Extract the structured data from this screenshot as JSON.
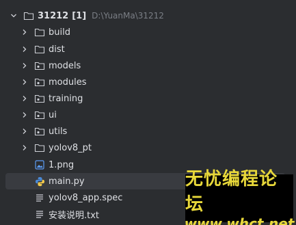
{
  "root": {
    "name": "31212",
    "count": "[1]",
    "path": "D:\\YuanMa\\31212"
  },
  "items": [
    {
      "label": "build",
      "type": "folder",
      "expandable": true
    },
    {
      "label": "dist",
      "type": "folder",
      "expandable": true
    },
    {
      "label": "models",
      "type": "package",
      "expandable": true
    },
    {
      "label": "modules",
      "type": "package",
      "expandable": true
    },
    {
      "label": "training",
      "type": "package",
      "expandable": true
    },
    {
      "label": "ui",
      "type": "package",
      "expandable": true
    },
    {
      "label": "utils",
      "type": "package",
      "expandable": true
    },
    {
      "label": "yolov8_pt",
      "type": "folder",
      "expandable": true
    },
    {
      "label": "1.png",
      "type": "image",
      "expandable": false
    },
    {
      "label": "main.py",
      "type": "python",
      "expandable": false,
      "selected": true
    },
    {
      "label": "yolov8_app.spec",
      "type": "text",
      "expandable": false
    },
    {
      "label": "安装说明.txt",
      "type": "text",
      "expandable": false
    }
  ],
  "watermark": {
    "top": "无忧编程论坛",
    "bottom": "www.whct.net"
  },
  "colors": {
    "background": "#2b2d30",
    "text": "#dfe1e5",
    "muted": "#7a7e85",
    "selected": "#393b40",
    "watermark": "#e8d83a"
  }
}
